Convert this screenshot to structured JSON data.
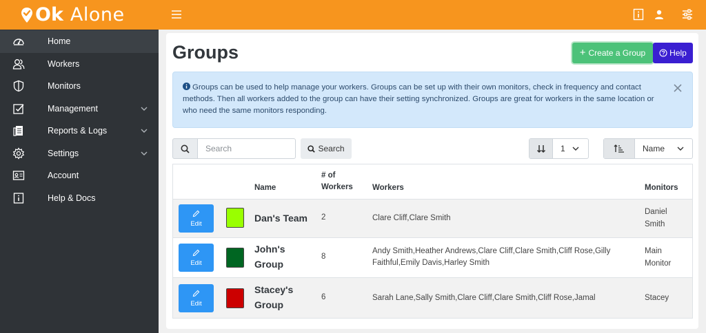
{
  "app": {
    "logo_bold": "Ok",
    "logo_light": "Alone"
  },
  "sidebar": {
    "items": [
      {
        "label": "Home",
        "icon": "dashboard-icon",
        "active": true
      },
      {
        "label": "Workers",
        "icon": "users-icon"
      },
      {
        "label": "Monitors",
        "icon": "shield-icon"
      },
      {
        "label": "Management",
        "icon": "checklist-icon",
        "has_submenu": true
      },
      {
        "label": "Reports & Logs",
        "icon": "report-icon",
        "has_submenu": true
      },
      {
        "label": "Settings",
        "icon": "gear-icon",
        "has_submenu": true
      },
      {
        "label": "Account",
        "icon": "id-card-icon"
      },
      {
        "label": "Help & Docs",
        "icon": "info-icon"
      }
    ]
  },
  "page": {
    "title": "Groups",
    "create_label": "Create a Group",
    "help_label": "Help",
    "info_text": "Groups can be used to help manage your workers. Groups can be set up with their own monitors, check in frequency and contact methods. Then all workers added to the group can have their setting synchronized. Groups are great for workers in the same location or who need the same monitors responding."
  },
  "toolbar": {
    "search_placeholder": "Search",
    "search_button": "Search",
    "page_size_value": "1",
    "sort_value": "Name"
  },
  "table": {
    "headers": {
      "name": "Name",
      "workers_count": "# of Workers",
      "workers": "Workers",
      "monitors": "Monitors"
    },
    "edit_label": "Edit",
    "rows": [
      {
        "name": "Dan's Team",
        "color": "#99ff00",
        "count": "2",
        "workers": "Clare Cliff,Clare Smith",
        "monitors": "Daniel Smith"
      },
      {
        "name": "John's Group",
        "color": "#006622",
        "count": "8",
        "workers": "Andy Smith,Heather Andrews,Clare Cliff,Clare Smith,Cliff Rose,Gilly Faithful,Emily Davis,Harley Smith",
        "monitors": "Main Monitor"
      },
      {
        "name": "Stacey's Group",
        "color": "#cc0000",
        "count": "6",
        "workers": "Sarah Lane,Sally Smith,Clare Cliff,Clare Smith,Cliff Rose,Jamal",
        "monitors": "Stacey"
      }
    ]
  },
  "colors": {
    "brand": "#f7951e",
    "sidebar": "#2f3337",
    "create": "#4cc279",
    "help": "#3a1fd1",
    "edit": "#2e96f5"
  }
}
